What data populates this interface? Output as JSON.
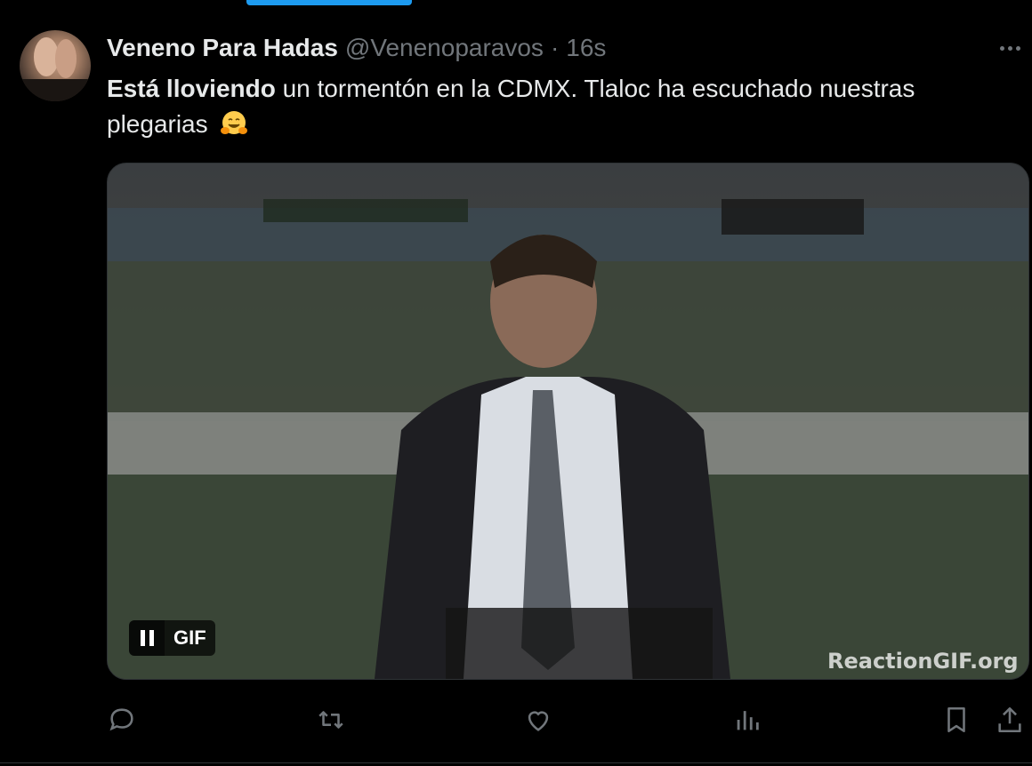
{
  "tweet": {
    "display_name": "Veneno Para Hadas",
    "handle": "@Venenoparavos",
    "separator": "·",
    "time": "16s",
    "text_bold": "Está lloviendo",
    "text_rest": " un tormentón en la CDMX. Tlaloc ha escuchado nuestras plegarias",
    "emoji": "hugging-face"
  },
  "media": {
    "badge_label": "GIF",
    "watermark": "ReactionGIF.org"
  },
  "actions": [
    "reply-icon",
    "retweet-icon",
    "like-icon",
    "views-icon",
    "bookmark-icon",
    "share-icon"
  ],
  "colors": {
    "background": "#000000",
    "text": "#e7e9ea",
    "muted": "#71767b",
    "accent": "#1d9bf0"
  }
}
